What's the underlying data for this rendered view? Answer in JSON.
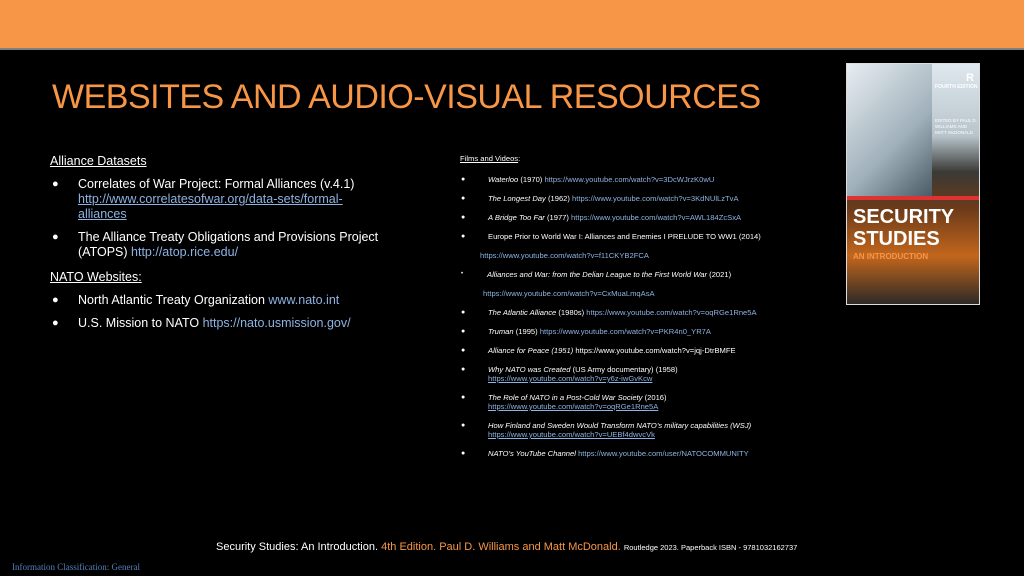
{
  "title": "WEBSITES AND AUDIO-VISUAL RESOURCES",
  "colors": {
    "accent": "#f79646",
    "link": "#8db3e2",
    "background": "#000000",
    "classification": "#4f81bd"
  },
  "left": {
    "alliance_heading": "Alliance Datasets",
    "alliance_items": [
      {
        "text": "Correlates of War Project: Formal Alliances (v.4.1)",
        "link": "http://www.correlatesofwar.org/data-sets/formal-alliances"
      },
      {
        "text": "The Alliance Treaty Obligations and Provisions Project (ATOPS)",
        "link": "http://atop.rice.edu/"
      }
    ],
    "nato_heading": "NATO Websites",
    "nato_items": [
      {
        "text": "North Atlantic Treaty Organization",
        "link": "www.nato.int"
      },
      {
        "text": "U.S. Mission to NATO",
        "link": "https://nato.usmission.gov/"
      }
    ]
  },
  "right": {
    "heading": "Films and Videos",
    "items": [
      {
        "title": "Waterloo",
        "year": "(1970)",
        "link": "https://www.youtube.com/watch?v=3DcWJrzK0wU"
      },
      {
        "title": "The Longest Day",
        "year": "(1962)",
        "link": "https://www.youtube.com/watch?v=3KdNUlLzTvA"
      },
      {
        "title": "A Bridge Too Far",
        "year": "(1977)",
        "link": "https://www.youtube.com/watch?v=AWL184ZcSxA"
      },
      {
        "title": "Europe Prior to World War I: Alliances and Enemies I PRELUDE TO WW1",
        "year": "(2014)",
        "link": "https://www.youtube.com/watch?v=f11CKYB2FCA"
      },
      {
        "title": "Alliances and War: from the Delian League to the First World War",
        "year": "(2021)",
        "link": "https://www.youtube.com/watch?v=CxMuaLmqAsA"
      },
      {
        "title": "The Atlantic Alliance",
        "year": "(1980s)",
        "link": "https://www.youtube.com/watch?v=oqRGe1Rne5A"
      },
      {
        "title": "Truman",
        "year": "(1995)",
        "link": "https://www.youtube.com/watch?v=PKR4n0_YR7A"
      },
      {
        "title": "Alliance for Peace (1951)",
        "year": "",
        "link": "https://www.youtube.com/watch?v=jqj-DtrBMFE"
      },
      {
        "title": "Why NATO was Created",
        "year": "(US Army documentary) (1958)",
        "link": "https://www.youtube.com/watch?v=y6z-iwGvKcw"
      },
      {
        "title": "The Role of NATO in a Post-Cold War Society",
        "year": "(2016)",
        "link": "https://www.youtube.com/watch?v=oqRGe1Rne5A"
      },
      {
        "title": "How Finland and Sweden Would Transform NATO’s military capabilities (WSJ)",
        "year": "",
        "link": "https://www.youtube.com/watch?v=UEBf4dwvcVk"
      },
      {
        "title": "NATO’s YouTube Channel",
        "year": "",
        "link": "https://www.youtube.com/user/NATOCOMMUNITY"
      }
    ]
  },
  "book": {
    "edition": "FOURTH EDITION",
    "editors": "EDITED BY PAUL D. WILLIAMS AND MATT McDONALD",
    "title_line1": "SECURITY",
    "title_line2": "STUDIES",
    "subtitle": "AN INTRODUCTION",
    "logo": "R"
  },
  "footer": {
    "book_title": "Security Studies: An Introduction.",
    "edition": "4th Edition.",
    "authors": "Paul D. Williams and Matt McDonald.",
    "publisher": "Routledge 2023. Paperback ISBN - 9781032162737"
  },
  "classification": "Information Classification: General"
}
